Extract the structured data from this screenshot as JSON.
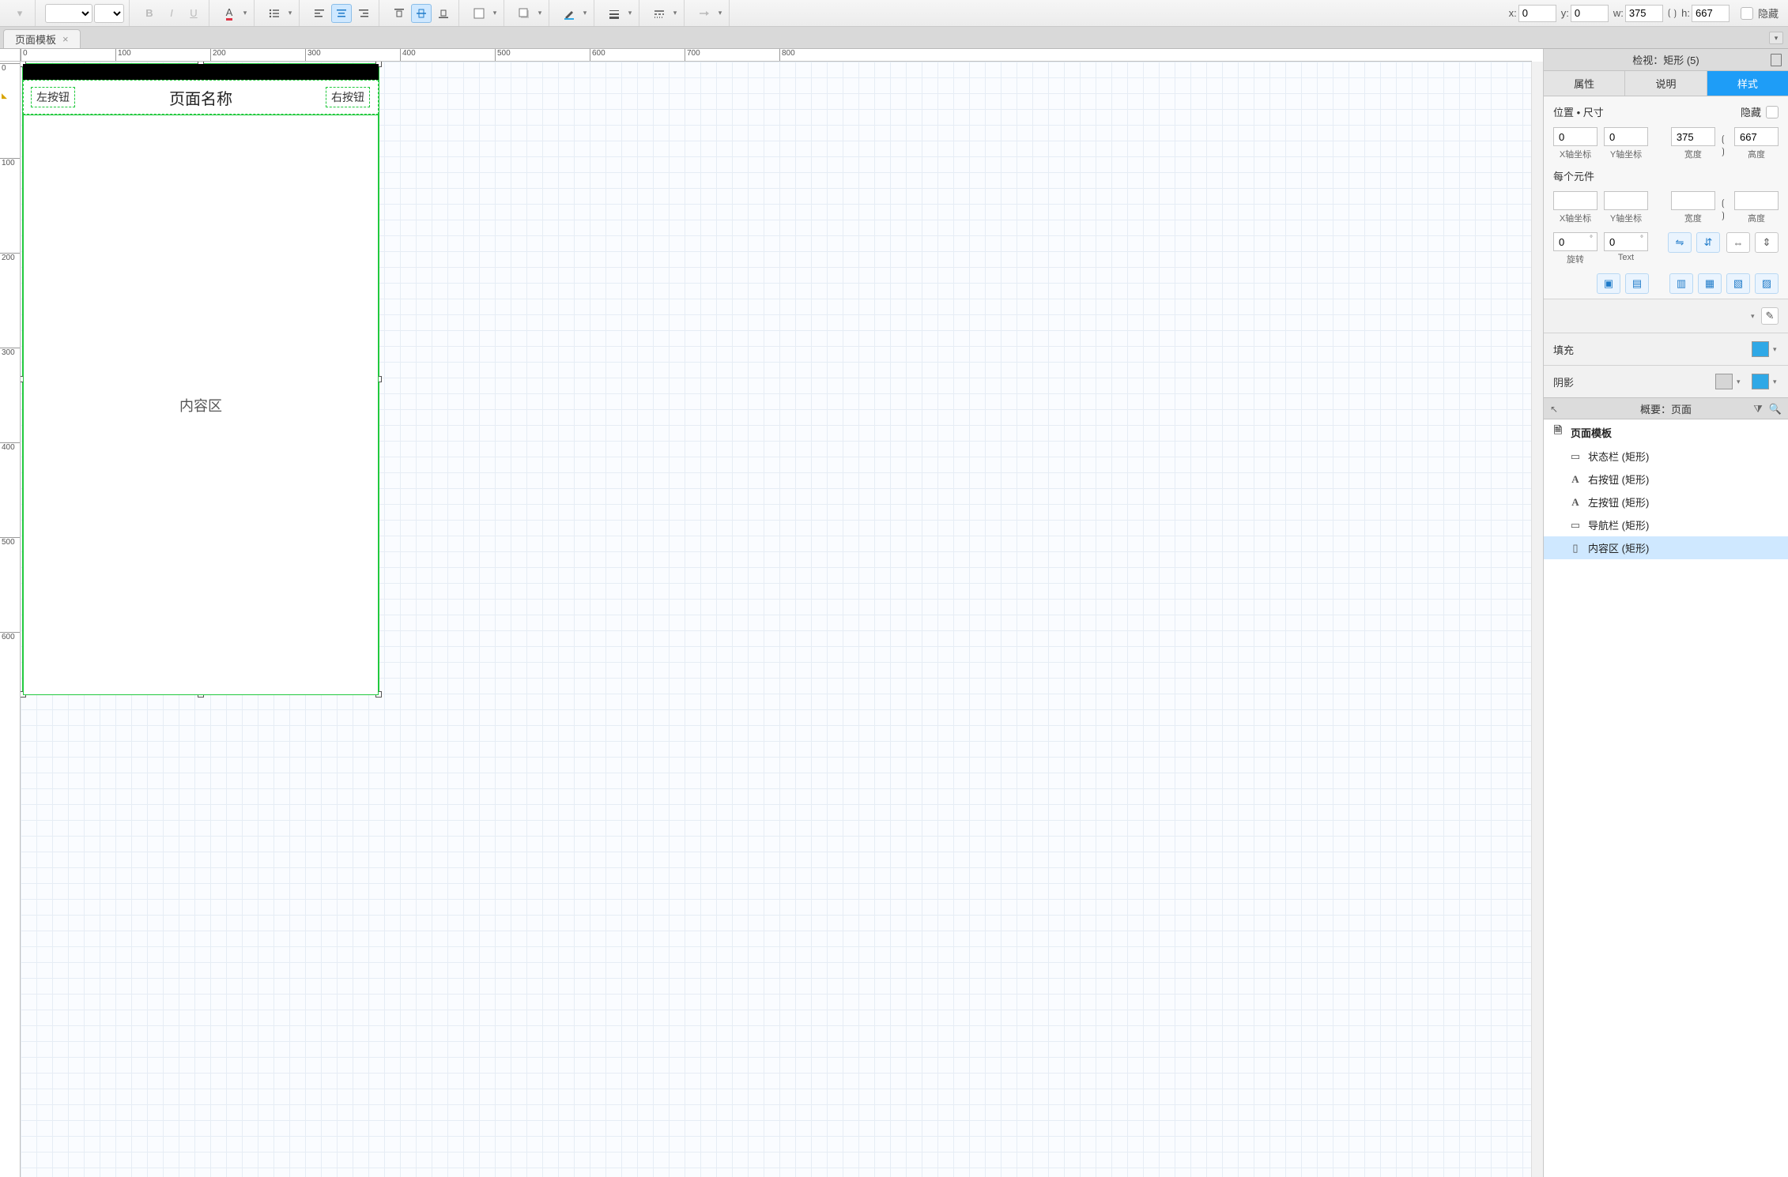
{
  "toolbar": {
    "coords": {
      "x_label": "x:",
      "x": "0",
      "y_label": "y:",
      "y": "0",
      "w_label": "w:",
      "w": "375",
      "h_label": "h:",
      "h": "667"
    },
    "hide_label": "隐藏"
  },
  "tabs": {
    "page_tab": "页面模板"
  },
  "ruler_h": [
    "0",
    "100",
    "200",
    "300",
    "400",
    "500",
    "600",
    "700",
    "800"
  ],
  "ruler_v": [
    "0",
    "100",
    "200",
    "300",
    "400",
    "500",
    "600"
  ],
  "canvas": {
    "page_title": "页面名称",
    "left_btn": "左按钮",
    "right_btn": "右按钮",
    "content_label": "内容区"
  },
  "inspector": {
    "title": "检视：矩形 (5)",
    "tabs": {
      "attr": "属性",
      "desc": "说明",
      "style": "样式"
    },
    "pos_size": "位置 • 尺寸",
    "hide": "隐藏",
    "fields": {
      "x": "0",
      "y": "0",
      "w": "375",
      "h": "667",
      "xlab": "X轴坐标",
      "ylab": "Y轴坐标",
      "wlab": "宽度",
      "hlab": "高度"
    },
    "each": "每个元件",
    "rot": "0",
    "rotlab": "旋转",
    "txt": "0",
    "txtlab": "Text",
    "fill": "填充",
    "shadow": "阴影"
  },
  "outline": {
    "title": "概要：页面",
    "items": [
      {
        "label": "页面模板",
        "kind": "page",
        "root": true
      },
      {
        "label": "状态栏 (矩形)",
        "kind": "rect"
      },
      {
        "label": "右按钮 (矩形)",
        "kind": "text"
      },
      {
        "label": "左按钮 (矩形)",
        "kind": "text"
      },
      {
        "label": "导航栏 (矩形)",
        "kind": "rect"
      },
      {
        "label": "内容区 (矩形)",
        "kind": "box",
        "selected": true
      }
    ]
  }
}
